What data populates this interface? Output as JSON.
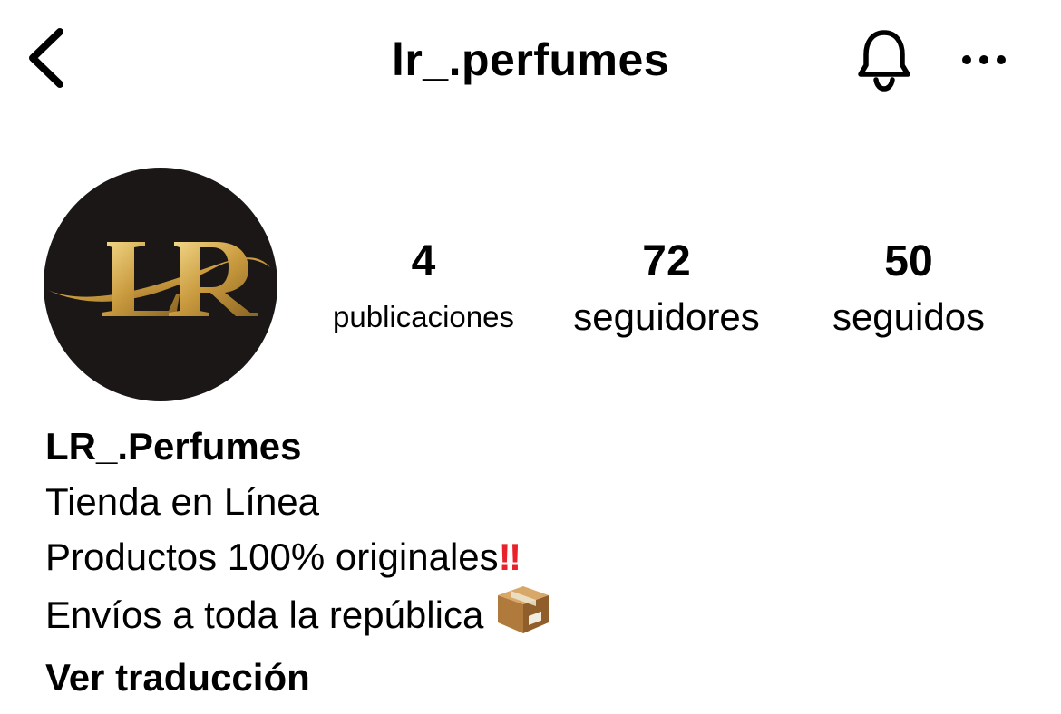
{
  "header": {
    "title": "lr_.perfumes",
    "back_icon": "chevron-left-icon",
    "bell_icon": "bell-icon",
    "more_icon": "more-horizontal-icon"
  },
  "avatar": {
    "logo_text": "LR",
    "background": "#1a1716",
    "accent": "#d4ad5a"
  },
  "stats": {
    "posts": {
      "value": "4",
      "label": "publicaciones"
    },
    "followers": {
      "value": "72",
      "label": "seguidores"
    },
    "following": {
      "value": "50",
      "label": "seguidos"
    }
  },
  "bio": {
    "name": "LR_.Perfumes",
    "line1": "Tienda en Línea",
    "line2": "Productos 100% originales",
    "line2_emoji": "‼",
    "line3": "Envíos a toda la república",
    "line3_emoji": "package-icon",
    "translate_link": "Ver traducción"
  }
}
